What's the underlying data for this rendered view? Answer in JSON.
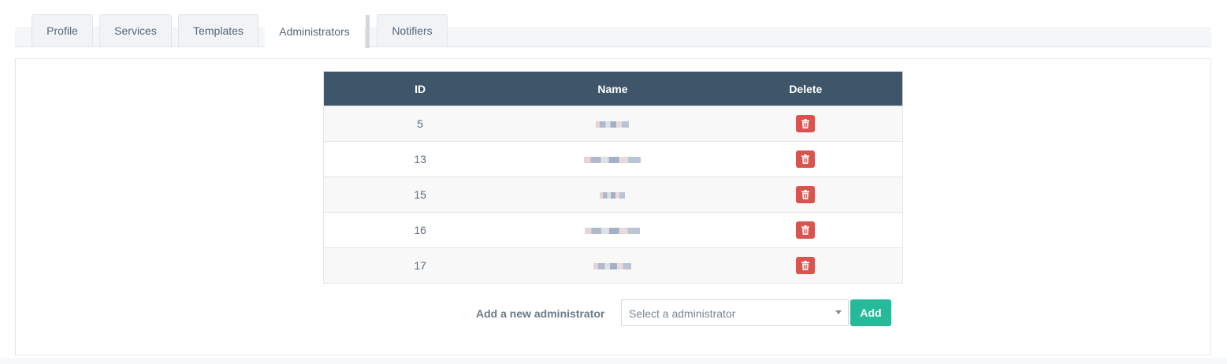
{
  "tabs": [
    {
      "label": "Profile"
    },
    {
      "label": "Services"
    },
    {
      "label": "Templates"
    },
    {
      "label": "Administrators",
      "active": true
    },
    {
      "label": "Notifiers"
    }
  ],
  "table": {
    "headers": {
      "id": "ID",
      "name": "Name",
      "delete": "Delete"
    },
    "rows": [
      {
        "id": "5",
        "name": ""
      },
      {
        "id": "13",
        "name": ""
      },
      {
        "id": "15",
        "name": ""
      },
      {
        "id": "16",
        "name": ""
      },
      {
        "id": "17",
        "name": ""
      }
    ]
  },
  "add_form": {
    "label": "Add a new administrator",
    "select_placeholder": "Select a administrator",
    "add_button": "Add"
  },
  "colors": {
    "header_bg": "#3f5569",
    "delete_button": "#d9534f",
    "add_button": "#26b99a"
  },
  "icons": {
    "delete": "trash-icon",
    "select": "chevron-down-icon"
  }
}
